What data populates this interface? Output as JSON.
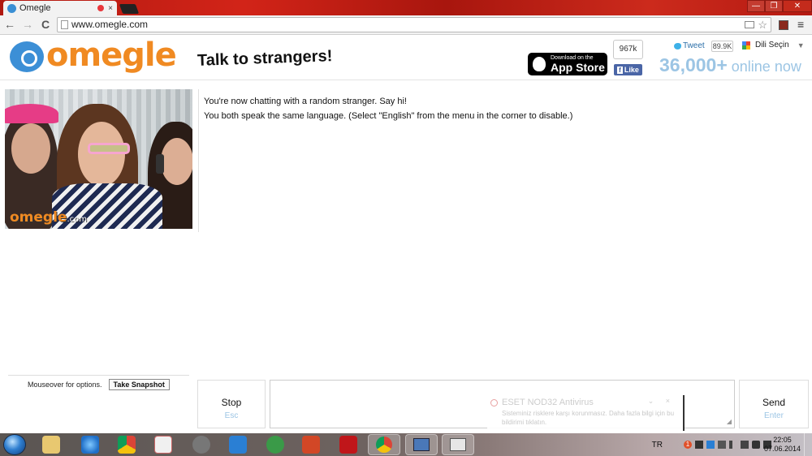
{
  "browser": {
    "tab_title": "Omegle",
    "url": "www.omegle.com",
    "back_glyph": "←",
    "forward_glyph": "→",
    "reload_glyph": "C",
    "menu_glyph": "≡",
    "star_glyph": "☆",
    "close_glyph": "×",
    "window_controls": {
      "minimize": "—",
      "restore": "❐",
      "close": "✕"
    }
  },
  "header": {
    "logo_text": "omegle",
    "tagline": "Talk to strangers!",
    "appstore": {
      "small": "Download on the",
      "big": "App Store"
    },
    "facebook": {
      "count": "967k",
      "like_label": "Like",
      "f_glyph": "f"
    },
    "twitter": {
      "label": "Tweet",
      "count": "89.9K"
    },
    "translate": {
      "label": "Dili Seçin",
      "arrow": "▼"
    },
    "online": {
      "count": "36,000+",
      "label": "online now"
    }
  },
  "video": {
    "watermark": "omegle",
    "watermark_suffix": ".com"
  },
  "chat": {
    "messages": [
      "You're now chatting with a random stranger. Say hi!",
      "You both speak the same language. (Select \"English\" from the menu in the corner to disable.)"
    ]
  },
  "options": {
    "hint": "Mouseover for options.",
    "snapshot_label": "Take Snapshot"
  },
  "controls": {
    "stop_label": "Stop",
    "stop_key": "Esc",
    "send_label": "Send",
    "send_key": "Enter",
    "message_value": ""
  },
  "notification": {
    "title": "ESET NOD32 Antivirus",
    "body": "Sisteminiz risklere karşı korunmasız. Daha fazla bilgi için bu bildirimi tıklatın.",
    "controls": "⌄ ×"
  },
  "taskbar": {
    "language": "TR",
    "tray_badge": "1",
    "time": "22:05",
    "date": "07.06.2014"
  },
  "colors": {
    "brand_orange": "#f08a22",
    "brand_blue": "#3c8fd6",
    "online_blue": "#9cc5e4"
  }
}
